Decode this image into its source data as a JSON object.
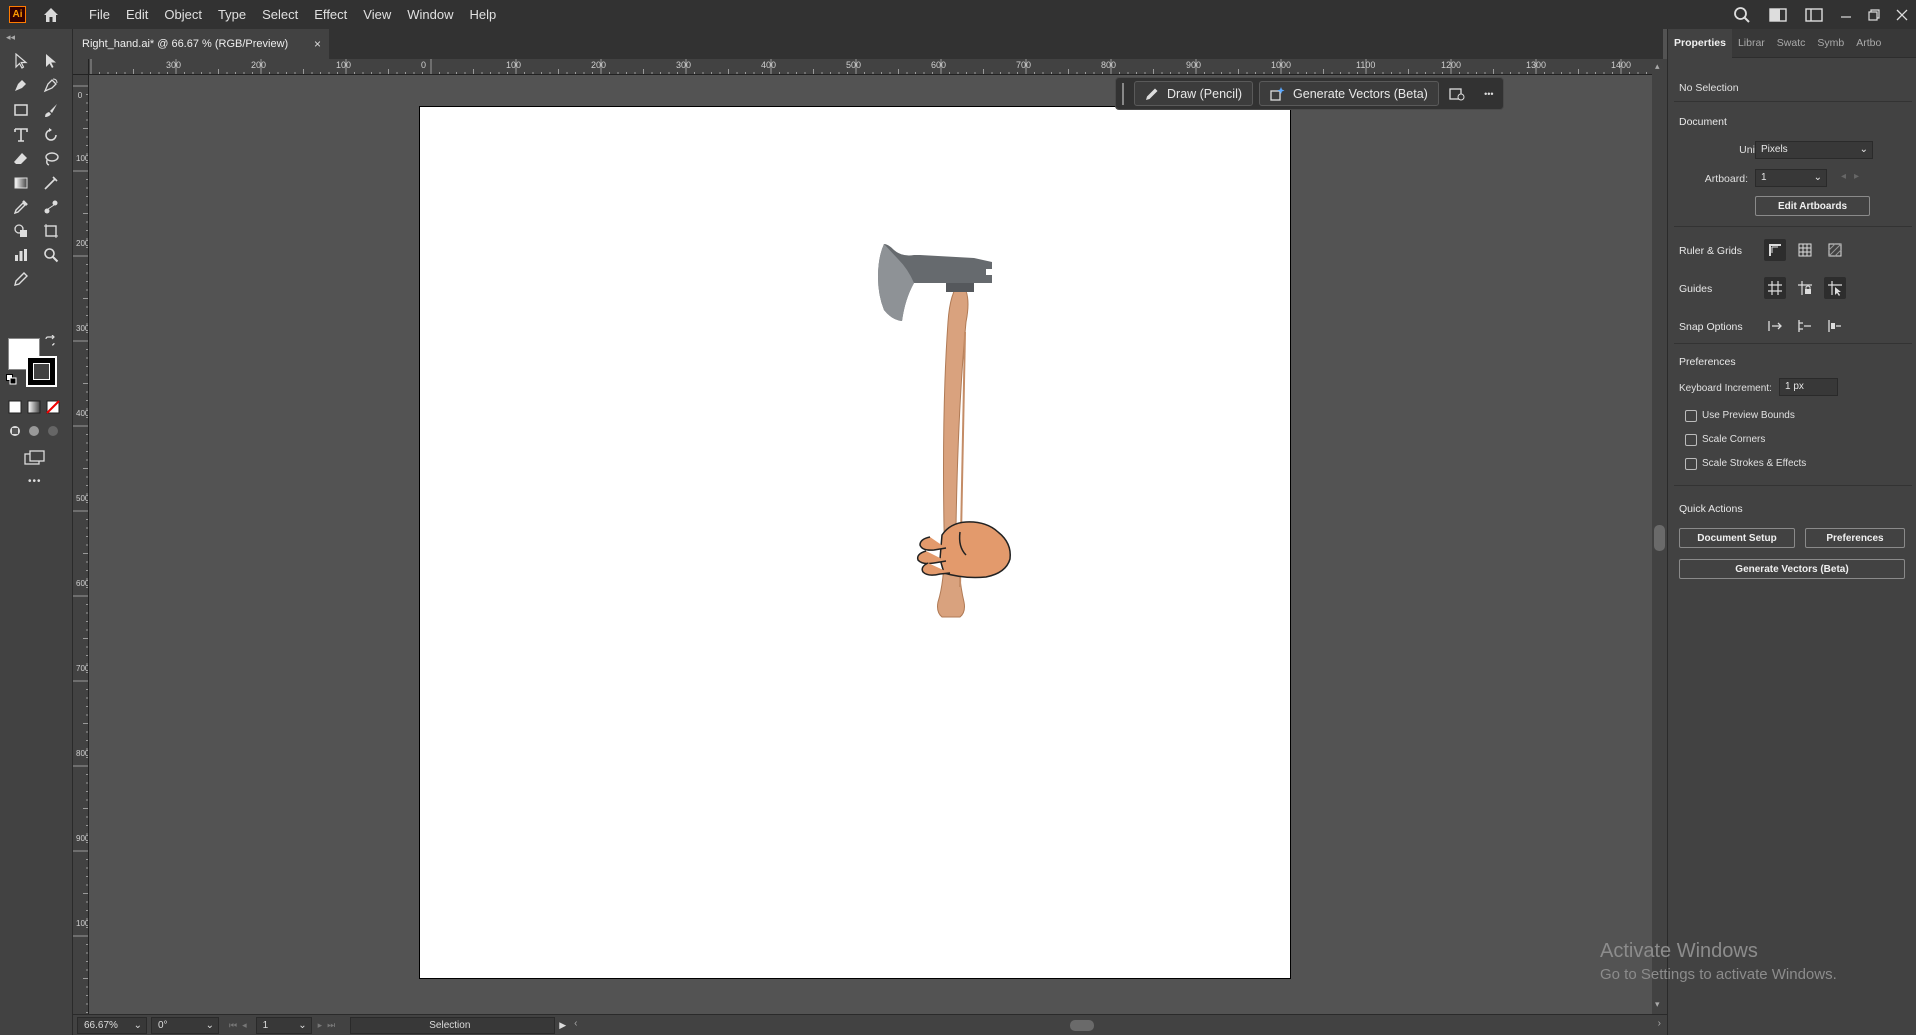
{
  "app": {
    "logo_text": "Ai"
  },
  "menu": {
    "items": [
      "File",
      "Edit",
      "Object",
      "Type",
      "Select",
      "Effect",
      "View",
      "Window",
      "Help"
    ]
  },
  "document": {
    "tab_title": "Right_hand.ai* @ 66.67 % (RGB/Preview)",
    "close_glyph": "×"
  },
  "rulers": {
    "top": [
      "300",
      "200",
      "100",
      "0",
      "100",
      "200",
      "300",
      "400",
      "500",
      "600",
      "700",
      "800",
      "900",
      "1000",
      "1100",
      "1200",
      "1300",
      "1400"
    ],
    "left": [
      "0",
      "100",
      "200",
      "300",
      "400",
      "500",
      "600",
      "700",
      "800",
      "900",
      "1000"
    ]
  },
  "context_bar": {
    "draw_label": "Draw (Pencil)",
    "generate_label": "Generate Vectors (Beta)",
    "more_glyph": "•••"
  },
  "toolbar": {
    "more_glyph": "•••"
  },
  "status": {
    "zoom": "66.67%",
    "rotation": "0°",
    "artboard_num": "1",
    "tool": "Selection"
  },
  "panel": {
    "tabs": [
      "Properties",
      "Librar",
      "Swatc",
      "Symb",
      "Artbo"
    ],
    "selection": "No Selection",
    "document_heading": "Document",
    "units_label": "Units:",
    "units_value": "Pixels",
    "artboard_label": "Artboard:",
    "artboard_value": "1",
    "edit_artboards": "Edit Artboards",
    "ruler_grids": "Ruler & Grids",
    "guides": "Guides",
    "snap_options": "Snap Options",
    "preferences_heading": "Preferences",
    "keyboard_increment_label": "Keyboard Increment:",
    "keyboard_increment_value": "1 px",
    "checkboxes": [
      "Use Preview Bounds",
      "Scale Corners",
      "Scale Strokes & Effects"
    ],
    "quick_actions": "Quick Actions",
    "document_setup": "Document Setup",
    "preferences_btn": "Preferences",
    "generate_vectors": "Generate Vectors (Beta)"
  },
  "watermark": {
    "title": "Activate Windows",
    "subtitle": "Go to Settings to activate Windows."
  },
  "colors": {
    "accent_logo": "#ff9a00",
    "handle": "#d9a27e",
    "axe_head": "#666a6e",
    "hand": "#e39a6c"
  }
}
